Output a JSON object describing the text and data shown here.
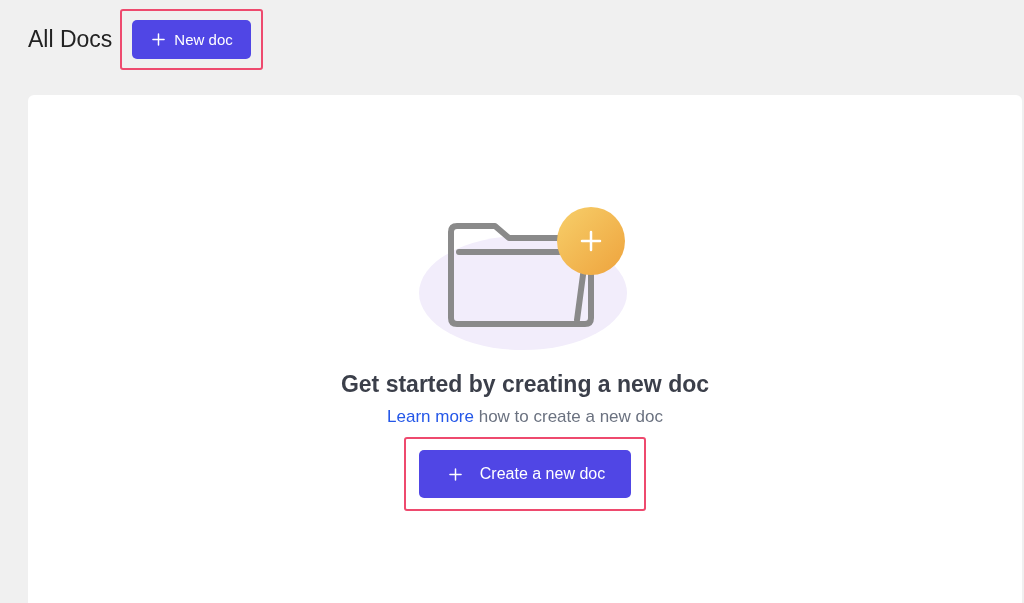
{
  "header": {
    "title": "All Docs",
    "new_button": {
      "label": "New doc",
      "highlighted": true
    }
  },
  "empty_state": {
    "heading": "Get started by creating a new doc",
    "link": "Learn more",
    "text": "how to create a new doc",
    "button": {
      "label": "Create a new doc",
      "highlighted": true
    }
  }
}
